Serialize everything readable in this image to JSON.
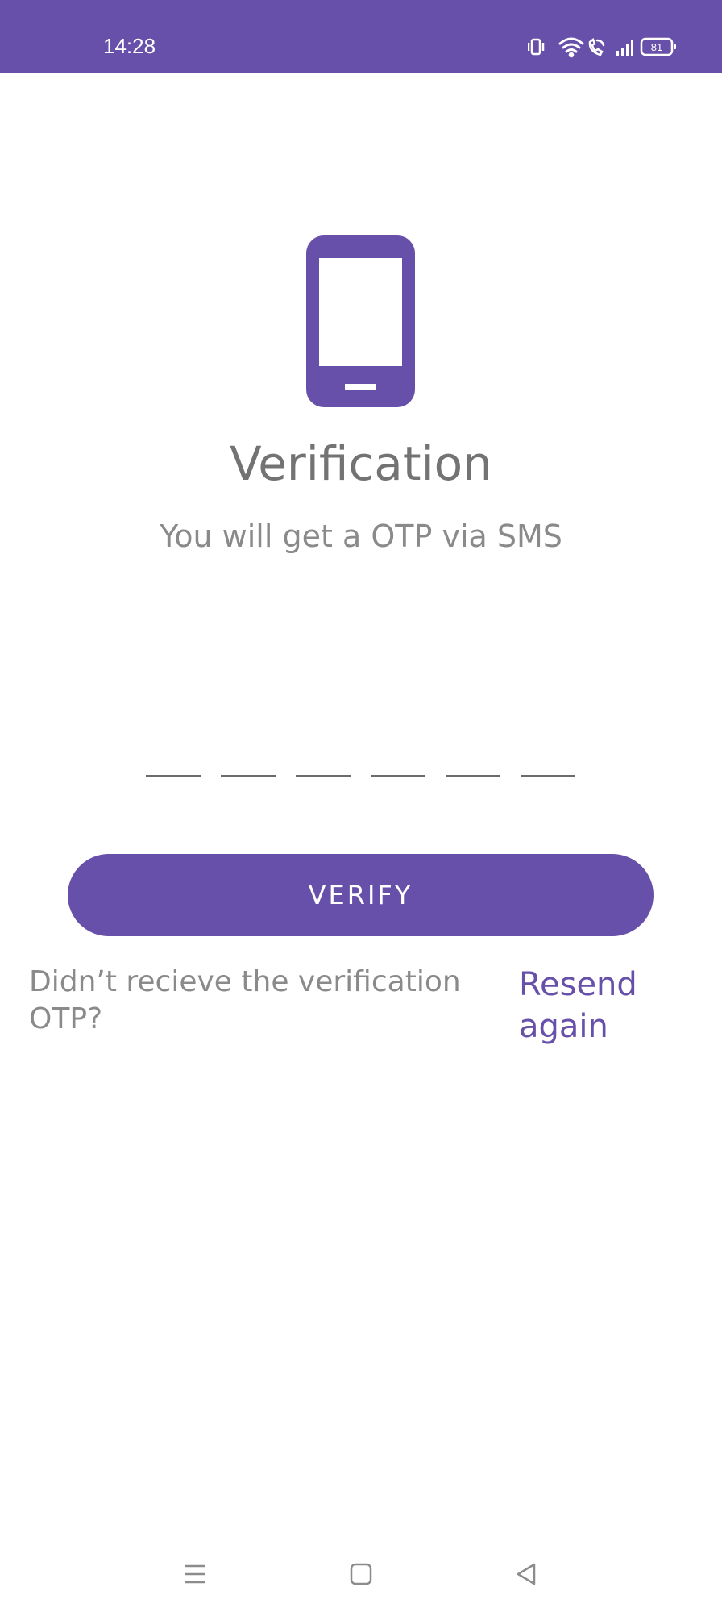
{
  "status_bar": {
    "time": "14:28",
    "battery_level": "81",
    "background_color": "#6750A9",
    "icons": [
      "vibrate-icon",
      "wifi-icon",
      "wifi-calling-icon",
      "signal-icon",
      "battery-icon"
    ]
  },
  "verification": {
    "illustration_icon": "smartphone-icon",
    "title": "Verification",
    "subtitle": "You will get a OTP via SMS",
    "otp_length": 6,
    "verify_label": "VERIFY",
    "resend_prompt": "Didn’t recieve the verification OTP?",
    "resend_link": "Resend again",
    "accent_color": "#6750A9"
  },
  "navigation": {
    "icons": [
      "menu-icon",
      "home-icon",
      "back-icon"
    ]
  }
}
